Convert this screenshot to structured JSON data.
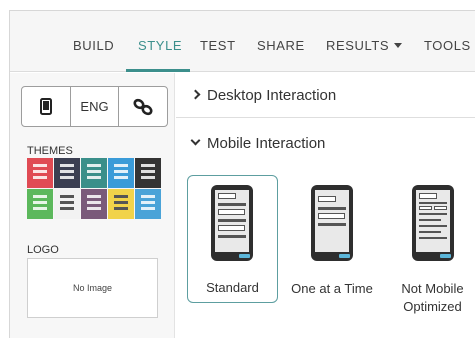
{
  "nav": {
    "tabs": [
      {
        "label": "BUILD"
      },
      {
        "label": "STYLE"
      },
      {
        "label": "TEST"
      },
      {
        "label": "SHARE"
      },
      {
        "label": "RESULTS"
      },
      {
        "label": "TOOLS"
      }
    ],
    "active_tab": "STYLE",
    "accent_color": "#3c8f8c"
  },
  "left_panel": {
    "device_toggle": {
      "items": [
        {
          "icon": "mobile-phone-icon"
        },
        {
          "label": "ENG"
        },
        {
          "icon": "link-icon"
        }
      ]
    },
    "themes_label": "THEMES",
    "theme_colors": [
      "#e04b54",
      "#3b3f52",
      "#3a8f8a",
      "#3a9bd8",
      "#343434",
      "#5cb85c",
      "#f2f2f2",
      "#7a5a7a",
      "#f1d34a",
      "#4aa3d8"
    ],
    "logo_label": "LOGO",
    "logo_placeholder": "No Image"
  },
  "content": {
    "desktop_section": "Desktop Interaction",
    "mobile_section": "Mobile Interaction",
    "mobile_options": [
      {
        "label": "Standard",
        "selected": true
      },
      {
        "label": "One at a Time",
        "selected": false
      },
      {
        "label": "Not Mobile Optimized",
        "selected": false
      }
    ]
  }
}
